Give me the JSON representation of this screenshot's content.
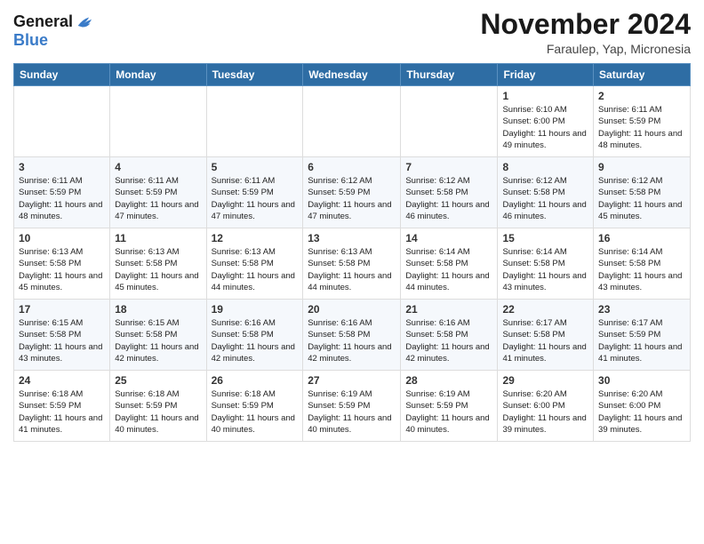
{
  "logo": {
    "line1": "General",
    "line2": "Blue"
  },
  "title": "November 2024",
  "subtitle": "Faraulep, Yap, Micronesia",
  "headers": [
    "Sunday",
    "Monday",
    "Tuesday",
    "Wednesday",
    "Thursday",
    "Friday",
    "Saturday"
  ],
  "weeks": [
    [
      {
        "day": "",
        "info": ""
      },
      {
        "day": "",
        "info": ""
      },
      {
        "day": "",
        "info": ""
      },
      {
        "day": "",
        "info": ""
      },
      {
        "day": "",
        "info": ""
      },
      {
        "day": "1",
        "info": "Sunrise: 6:10 AM\nSunset: 6:00 PM\nDaylight: 11 hours and 49 minutes."
      },
      {
        "day": "2",
        "info": "Sunrise: 6:11 AM\nSunset: 5:59 PM\nDaylight: 11 hours and 48 minutes."
      }
    ],
    [
      {
        "day": "3",
        "info": "Sunrise: 6:11 AM\nSunset: 5:59 PM\nDaylight: 11 hours and 48 minutes."
      },
      {
        "day": "4",
        "info": "Sunrise: 6:11 AM\nSunset: 5:59 PM\nDaylight: 11 hours and 47 minutes."
      },
      {
        "day": "5",
        "info": "Sunrise: 6:11 AM\nSunset: 5:59 PM\nDaylight: 11 hours and 47 minutes."
      },
      {
        "day": "6",
        "info": "Sunrise: 6:12 AM\nSunset: 5:59 PM\nDaylight: 11 hours and 47 minutes."
      },
      {
        "day": "7",
        "info": "Sunrise: 6:12 AM\nSunset: 5:58 PM\nDaylight: 11 hours and 46 minutes."
      },
      {
        "day": "8",
        "info": "Sunrise: 6:12 AM\nSunset: 5:58 PM\nDaylight: 11 hours and 46 minutes."
      },
      {
        "day": "9",
        "info": "Sunrise: 6:12 AM\nSunset: 5:58 PM\nDaylight: 11 hours and 45 minutes."
      }
    ],
    [
      {
        "day": "10",
        "info": "Sunrise: 6:13 AM\nSunset: 5:58 PM\nDaylight: 11 hours and 45 minutes."
      },
      {
        "day": "11",
        "info": "Sunrise: 6:13 AM\nSunset: 5:58 PM\nDaylight: 11 hours and 45 minutes."
      },
      {
        "day": "12",
        "info": "Sunrise: 6:13 AM\nSunset: 5:58 PM\nDaylight: 11 hours and 44 minutes."
      },
      {
        "day": "13",
        "info": "Sunrise: 6:13 AM\nSunset: 5:58 PM\nDaylight: 11 hours and 44 minutes."
      },
      {
        "day": "14",
        "info": "Sunrise: 6:14 AM\nSunset: 5:58 PM\nDaylight: 11 hours and 44 minutes."
      },
      {
        "day": "15",
        "info": "Sunrise: 6:14 AM\nSunset: 5:58 PM\nDaylight: 11 hours and 43 minutes."
      },
      {
        "day": "16",
        "info": "Sunrise: 6:14 AM\nSunset: 5:58 PM\nDaylight: 11 hours and 43 minutes."
      }
    ],
    [
      {
        "day": "17",
        "info": "Sunrise: 6:15 AM\nSunset: 5:58 PM\nDaylight: 11 hours and 43 minutes."
      },
      {
        "day": "18",
        "info": "Sunrise: 6:15 AM\nSunset: 5:58 PM\nDaylight: 11 hours and 42 minutes."
      },
      {
        "day": "19",
        "info": "Sunrise: 6:16 AM\nSunset: 5:58 PM\nDaylight: 11 hours and 42 minutes."
      },
      {
        "day": "20",
        "info": "Sunrise: 6:16 AM\nSunset: 5:58 PM\nDaylight: 11 hours and 42 minutes."
      },
      {
        "day": "21",
        "info": "Sunrise: 6:16 AM\nSunset: 5:58 PM\nDaylight: 11 hours and 42 minutes."
      },
      {
        "day": "22",
        "info": "Sunrise: 6:17 AM\nSunset: 5:58 PM\nDaylight: 11 hours and 41 minutes."
      },
      {
        "day": "23",
        "info": "Sunrise: 6:17 AM\nSunset: 5:59 PM\nDaylight: 11 hours and 41 minutes."
      }
    ],
    [
      {
        "day": "24",
        "info": "Sunrise: 6:18 AM\nSunset: 5:59 PM\nDaylight: 11 hours and 41 minutes."
      },
      {
        "day": "25",
        "info": "Sunrise: 6:18 AM\nSunset: 5:59 PM\nDaylight: 11 hours and 40 minutes."
      },
      {
        "day": "26",
        "info": "Sunrise: 6:18 AM\nSunset: 5:59 PM\nDaylight: 11 hours and 40 minutes."
      },
      {
        "day": "27",
        "info": "Sunrise: 6:19 AM\nSunset: 5:59 PM\nDaylight: 11 hours and 40 minutes."
      },
      {
        "day": "28",
        "info": "Sunrise: 6:19 AM\nSunset: 5:59 PM\nDaylight: 11 hours and 40 minutes."
      },
      {
        "day": "29",
        "info": "Sunrise: 6:20 AM\nSunset: 6:00 PM\nDaylight: 11 hours and 39 minutes."
      },
      {
        "day": "30",
        "info": "Sunrise: 6:20 AM\nSunset: 6:00 PM\nDaylight: 11 hours and 39 minutes."
      }
    ]
  ]
}
